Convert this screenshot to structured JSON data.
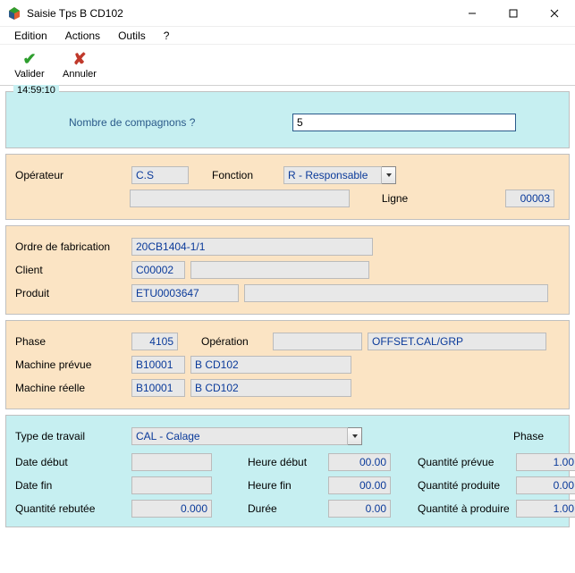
{
  "window": {
    "title": "Saisie Tps B CD102"
  },
  "menu": {
    "edition": "Edition",
    "actions": "Actions",
    "outils": "Outils",
    "help": "?"
  },
  "toolbar": {
    "validate": "Valider",
    "cancel": "Annuler"
  },
  "prompt": {
    "time": "14:59:10",
    "label": "Nombre de compagnons ?",
    "value": "5"
  },
  "operator": {
    "label": "Opérateur",
    "code": "C.S",
    "fonction_label": "Fonction",
    "fonction_value": "R - Responsable",
    "line_label": "Ligne",
    "line_value": "00003",
    "desc": ""
  },
  "ordre": {
    "of_label": "Ordre de fabrication",
    "of_value": "20CB1404-1/1",
    "client_label": "Client",
    "client_value": "C00002",
    "client_desc": "",
    "produit_label": "Produit",
    "produit_value": "ETU0003647",
    "produit_desc": ""
  },
  "phase": {
    "phase_label": "Phase",
    "phase_value": "4105",
    "operation_label": "Opération",
    "operation_value": "",
    "operation_desc": "OFFSET.CAL/GRP",
    "machine_prevue_label": "Machine prévue",
    "machine_prevue_code": "B10001",
    "machine_prevue_name": "B CD102",
    "machine_reelle_label": "Machine réelle",
    "machine_reelle_code": "B10001",
    "machine_reelle_name": "B CD102"
  },
  "work": {
    "type_label": "Type de travail",
    "type_value": "CAL - Calage",
    "phase_header": "Phase",
    "date_debut_label": "Date début",
    "date_debut_value": "",
    "heure_debut_label": "Heure début",
    "heure_debut_value": "00.00",
    "qte_prevue_label": "Quantité prévue",
    "qte_prevue_value": "1.00",
    "date_fin_label": "Date fin",
    "date_fin_value": "",
    "heure_fin_label": "Heure fin",
    "heure_fin_value": "00.00",
    "qte_produite_label": "Quantité produite",
    "qte_produite_value": "0.00",
    "qte_rebutee_label": "Quantité rebutée",
    "qte_rebutee_value": "0.000",
    "duree_label": "Durée",
    "duree_value": "0.00",
    "qte_a_produire_label": "Quantité à produire",
    "qte_a_produire_value": "1.00"
  }
}
